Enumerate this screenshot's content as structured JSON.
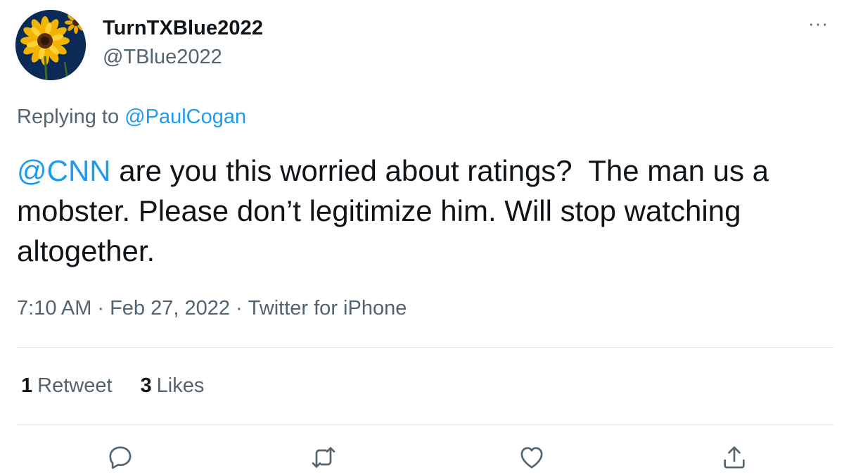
{
  "user": {
    "display_name": "TurnTXBlue2022",
    "handle": "@TBlue2022",
    "avatar_icon": "sunflower-avatar"
  },
  "more_label": "···",
  "reply": {
    "prefix": "Replying to ",
    "mention": "@PaulCogan"
  },
  "tweet": {
    "mention": "@CNN",
    "text": " are you this worried about ratings?  The man us a mobster. Please don’t legitimize him. Will stop watching altogether."
  },
  "meta": {
    "time": "7:10 AM",
    "separator": "·",
    "date": "Feb 27, 2022",
    "source": "Twitter for iPhone"
  },
  "stats": {
    "retweets_count": "1",
    "retweets_label": "Retweet",
    "likes_count": "3",
    "likes_label": "Likes"
  },
  "actions": {
    "reply_icon": "reply-icon",
    "retweet_icon": "retweet-icon",
    "like_icon": "heart-icon",
    "share_icon": "share-icon"
  },
  "colors": {
    "link": "#1d9bf0",
    "secondary_text": "#536471",
    "primary_text": "#0f1419"
  }
}
